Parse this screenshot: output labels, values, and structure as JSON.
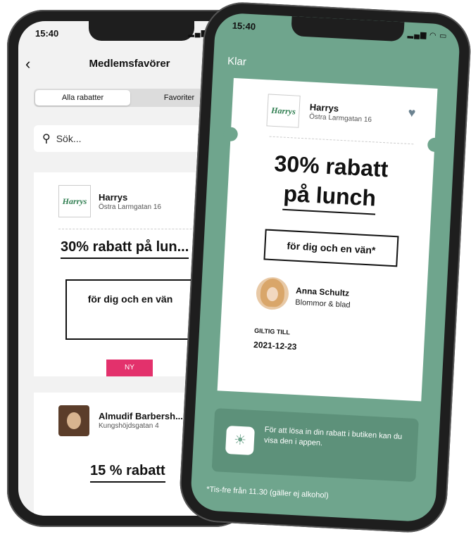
{
  "left_phone": {
    "status": {
      "time": "15:40",
      "indicators": "▂▄▆ ◠ ▭"
    },
    "nav": {
      "back_icon": "‹",
      "title": "Medlemsfavörer",
      "info_icon": "i"
    },
    "segments": [
      "Alla rabatter",
      "Favoriter"
    ],
    "search": {
      "placeholder": "Sök..."
    },
    "card1": {
      "logo_text": "Harrys",
      "business": "Harrys",
      "address": "Östra Larmgatan 16",
      "offer": "30% rabatt på lun...",
      "detail": "för dig och en vän",
      "badge": "NY"
    },
    "card2": {
      "business": "Almudif Barbersh...",
      "address": "Kungshöjdsgatan 4",
      "offer": "15 % rabatt"
    }
  },
  "right_phone": {
    "status": {
      "time": "15:40",
      "indicators": "▂▄▆ ◠ ▭"
    },
    "close_label": "Klar",
    "ticket": {
      "logo_text": "Harrys",
      "business": "Harrys",
      "address": "Östra Larmgatan 16",
      "offer_line1": "30% rabatt",
      "offer_line2": "på lunch",
      "detail": "för dig och en vän*",
      "person_name": "Anna Schultz",
      "person_company": "Blommor & blad",
      "valid_label": "GILTIG TILL",
      "valid_date": "2021-12-23"
    },
    "info_text": "För att lösa in din rabatt i butiken kan du visa den i appen.",
    "footnote": "*Tis-fre från 11.30 (gäller ej alkohol)"
  },
  "colors": {
    "accent_green": "#6fa58d",
    "badge_pink": "#e3316c",
    "heart": "#6b8290"
  }
}
